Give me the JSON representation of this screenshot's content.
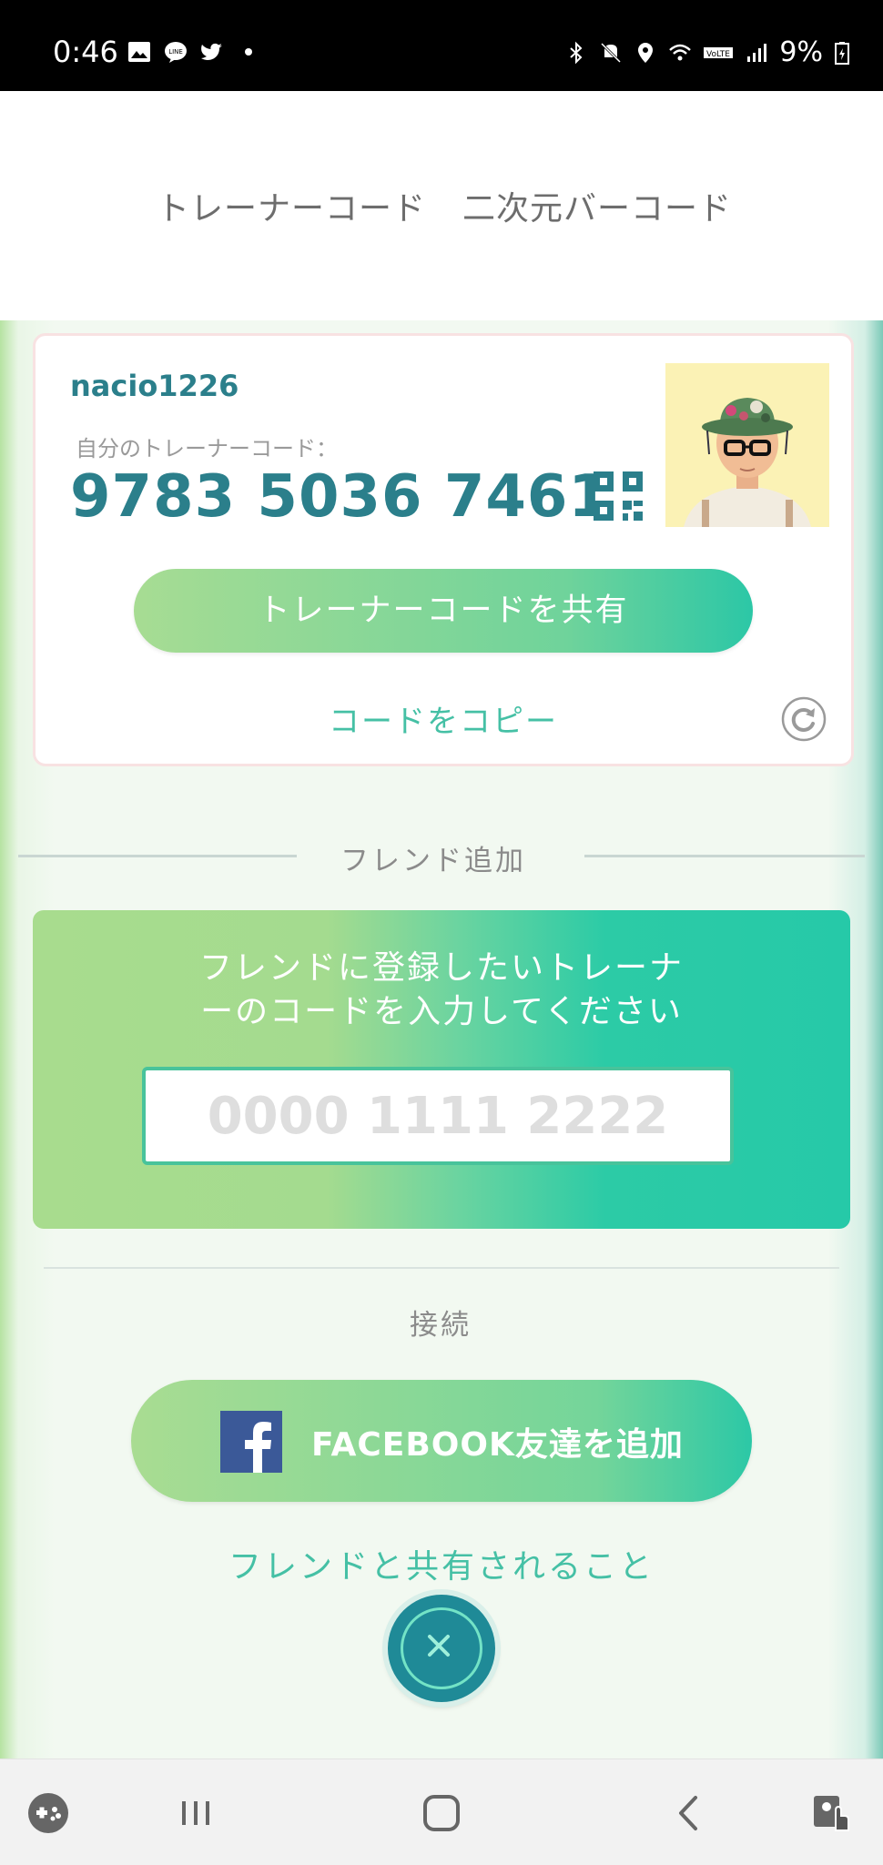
{
  "status_bar": {
    "time": "0:46",
    "battery": "9%",
    "icons": [
      "gallery-icon",
      "line-icon",
      "twitter-icon",
      "dot-icon",
      "bluetooth-icon",
      "mute-icon",
      "location-icon",
      "wifi-icon",
      "volte-icon",
      "signal-icon",
      "battery-icon"
    ]
  },
  "tabs": {
    "trainer_code": "トレーナーコード",
    "qr_code": "二次元バーコード",
    "active": "trainer_code"
  },
  "card": {
    "username": "nacio1226",
    "code_label": "自分のトレーナーコード：",
    "code": "9783 5036 7461",
    "share_button": "トレーナーコードを共有",
    "copy_link": "コードをコピー"
  },
  "add_friend": {
    "section_title": "フレンド追加",
    "instruction_line1": "フレンドに登録したいトレーナ",
    "instruction_line2": "ーのコードを入力してください",
    "input_placeholder": "0000 1111 2222",
    "input_value": ""
  },
  "connect": {
    "section_title": "接続",
    "facebook_button": "FACEBOOK友達を追加",
    "shared_link": "フレンドと共有されること"
  },
  "colors": {
    "accent_teal": "#2b7f8b",
    "accent_green": "#45c0a5",
    "facebook_blue": "#3b5998"
  },
  "nav_bar": {
    "icons": [
      "game-launcher-icon",
      "recent-apps-icon",
      "home-icon",
      "back-icon",
      "accessibility-icon"
    ]
  }
}
